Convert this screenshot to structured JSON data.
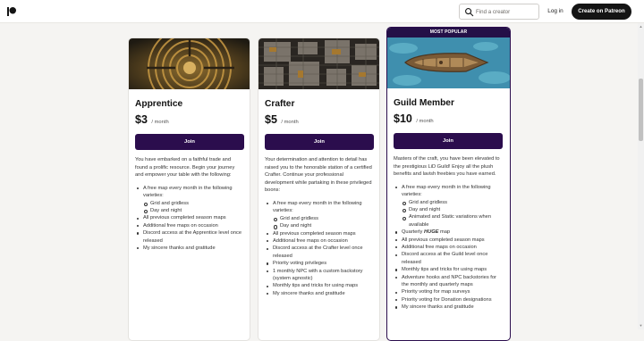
{
  "header": {
    "search_placeholder": "Find a creator",
    "login_label": "Log in",
    "create_label": "Create on Patreon",
    "logo_icon": "patreon-logo-icon",
    "search_icon": "search-icon"
  },
  "colors": {
    "brand_dark": "#2b0d4d",
    "ribbon": "#241047",
    "page_bg": "#f5f4f2"
  },
  "tiers": [
    {
      "name": "Apprentice",
      "price": "$3",
      "period": "/ month",
      "join_label": "Join",
      "image_icon": "circular-stone-maze-map",
      "description": "You have embarked on a faithful trade and found a prolific resource. Begin your journey and empower your table with the following:",
      "benefits": [
        "A free map every month in the following varieties:",
        "Grid and gridless",
        "Day and night",
        "All previous completed season maps",
        "Additional free maps on occasion",
        "Discord access at the Apprentice level once released",
        "My sincere thanks and gratitude"
      ]
    },
    {
      "name": "Crafter",
      "price": "$5",
      "period": "/ month",
      "join_label": "Join",
      "image_icon": "dungeon-rooms-map",
      "description": "Your determination and attention to detail has raised you to the honorable station of a certified Crafter. Continue your professional development while partaking in these privileged boons:",
      "benefits": [
        "A free map every month in the following varieties:",
        "Grid and gridless",
        "Day and night",
        "All previous completed season maps",
        "Additional free maps on occasion",
        "Discord access at the Crafter level once released",
        "Priority voting privileges",
        "1 monthly NPC with a custom backstory (system agnostic)",
        "Monthly tips and tricks for using maps",
        "My sincere thanks and gratitude"
      ]
    },
    {
      "name": "Guild Member",
      "price": "$10",
      "period": "/ month",
      "join_label": "Join",
      "ribbon": "MOST POPULAR",
      "image_icon": "ship-on-water-map",
      "description": "Masters of the craft, you have been elevated to the prestigious LiD Guild! Enjoy all the plush benefits and lavish freebies you have earned.",
      "benefits": [
        "A free map every month in the following varieties:",
        "Grid and gridless",
        "Day and night",
        "Animated and Static variations when available",
        "Quarterly",
        "HUGE",
        "map",
        "All previous completed season maps",
        "Additional free maps on occasion",
        "Discord access at the Guild level once released",
        "Monthly tips and tricks for using maps",
        "Adventure hooks and NPC backstories for the monthly and quarterly maps",
        "Priority voting for map surveys",
        "Priority voting for Donation designations",
        "My sincere thanks and gratitude"
      ]
    }
  ]
}
